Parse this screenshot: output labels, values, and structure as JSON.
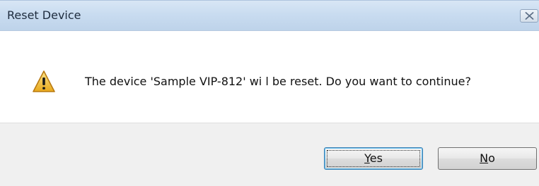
{
  "window": {
    "title": "Reset Device",
    "close_icon": "close-icon"
  },
  "message": {
    "icon": "warning-icon",
    "text": "The device 'Sample VIP-812' wi l be reset.  Do you want to continue?"
  },
  "buttons": {
    "yes": {
      "mnemonic": "Y",
      "rest": "es",
      "focused": true
    },
    "no": {
      "mnemonic": "N",
      "rest": "o"
    }
  },
  "colors": {
    "titlebar": "#c9dcf0",
    "footer": "#f0f0f0",
    "warning_fill": "#f2c232",
    "focus_border": "#3c7fb1"
  }
}
